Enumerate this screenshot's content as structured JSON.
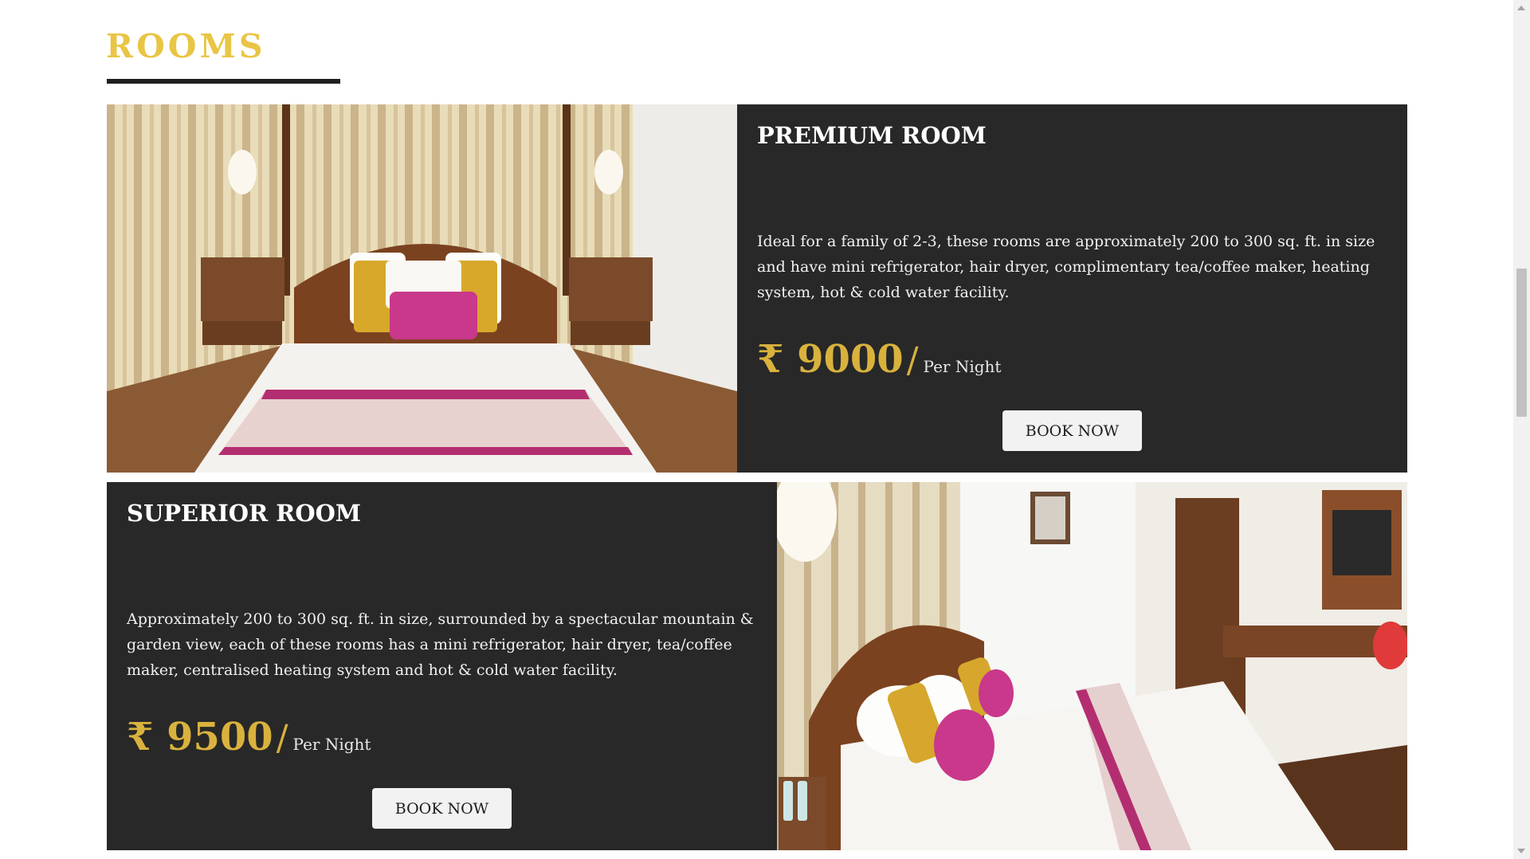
{
  "section": {
    "title": "ROOMS"
  },
  "rooms": [
    {
      "name": "PREMIUM ROOM",
      "description": "Ideal for a family of 2-3, these rooms are approximately 200 to 300 sq. ft. in size and have mini refrigerator, hair dryer, complimentary tea/coffee maker, heating system, hot & cold water facility.",
      "price": "₹ 9000",
      "price_slash": "/",
      "price_unit": "Per Night",
      "button_label": "BOOK NOW"
    },
    {
      "name": "SUPERIOR ROOM",
      "description": "Approximately 200 to 300 sq. ft. in size, surrounded by a spectacular mountain & garden view, each of these rooms has a mini refrigerator, hair dryer, tea/coffee maker, centralised heating system and hot & cold water facility.",
      "price": "₹ 9500",
      "price_slash": "/",
      "price_unit": "Per Night",
      "button_label": "BOOK NOW"
    }
  ],
  "colors": {
    "title_gold": "#e9c545",
    "price_gold": "#d9b23d",
    "panel_bg": "#282828",
    "button_bg": "#f2f2f2"
  }
}
